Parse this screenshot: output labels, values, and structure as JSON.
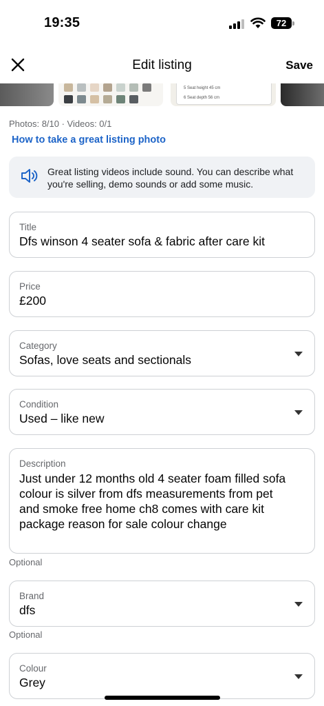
{
  "status_bar": {
    "time": "19:35",
    "battery": "72"
  },
  "nav": {
    "title": "Edit listing",
    "save_label": "Save"
  },
  "photo_strip": {
    "swatch_colors": [
      "#c8b79c",
      "#b9bfc0",
      "#e6d6c6",
      "#b3a38e",
      "#c9d2cd",
      "#b4bdb6",
      "#7b7b7b",
      "#3b3f43",
      "#7d8a8f",
      "#d5c0a4",
      "#b5ab95",
      "#6e8478",
      "#595e62"
    ],
    "table_rows": [
      "5   Seat height          45 cm",
      "6   Seat depth           56 cm"
    ]
  },
  "media_counts": "Photos: 8/10 · Videos: 0/1",
  "help_link": "How to take a great listing photo",
  "tip": {
    "icon": "speaker-icon",
    "text": "Great listing videos include sound. You can describe what you're selling, demo sounds or add some music."
  },
  "fields": {
    "title": {
      "label": "Title",
      "value": "Dfs winson 4 seater sofa & fabric after care kit"
    },
    "price": {
      "label": "Price",
      "value": "£200"
    },
    "category": {
      "label": "Category",
      "value": "Sofas, love seats and sectionals"
    },
    "condition": {
      "label": "Condition",
      "value": "Used – like new"
    },
    "description": {
      "label": "Description",
      "value": "Just under 12 months old 4 seater foam filled sofa colour is silver from dfs measurements from pet and smoke free home ch8 comes with care kit package reason for sale colour change"
    },
    "brand": {
      "label": "Brand",
      "value": "dfs"
    },
    "colour": {
      "label": "Colour",
      "value": "Grey"
    }
  },
  "optional_label": "Optional",
  "colors": {
    "link": "#1d64c8",
    "border": "#cdd0d4",
    "tip_bg": "#f0f2f5"
  }
}
